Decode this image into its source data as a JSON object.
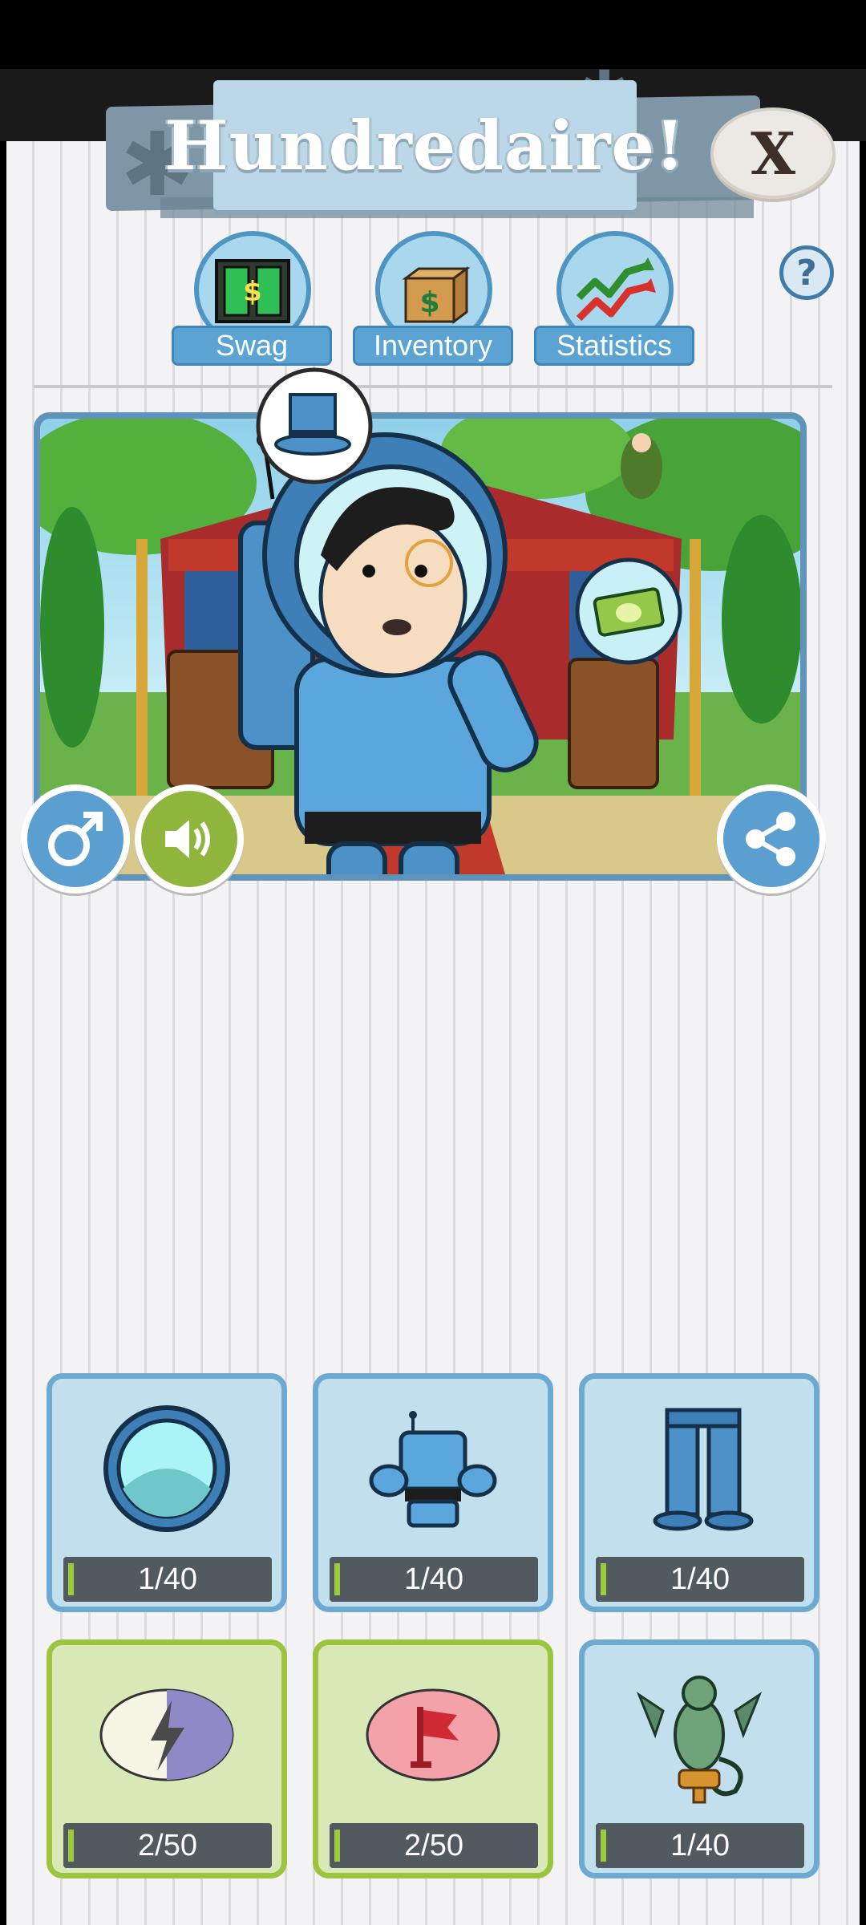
{
  "header": {
    "title": "Hundredaire!",
    "close_label": "X",
    "help_label": "?"
  },
  "tabs": [
    {
      "label": "Swag",
      "icon": "swag-cabinet-icon"
    },
    {
      "label": "Inventory",
      "icon": "inventory-box-icon"
    },
    {
      "label": "Statistics",
      "icon": "statistics-arrows-icon"
    }
  ],
  "controls": {
    "gender_icon": "male-symbol-icon",
    "sound_icon": "speaker-icon",
    "share_icon": "share-icon"
  },
  "slots": [
    {
      "count": "1/40",
      "progress": 0.025,
      "item": "helmet",
      "style": "blue"
    },
    {
      "count": "1/40",
      "progress": 0.025,
      "item": "robot-armor",
      "style": "blue"
    },
    {
      "count": "1/40",
      "progress": 0.025,
      "item": "pants",
      "style": "blue"
    },
    {
      "count": "2/50",
      "progress": 0.04,
      "item": "energy-lightning",
      "style": "green"
    },
    {
      "count": "2/50",
      "progress": 0.04,
      "item": "flag",
      "style": "green"
    },
    {
      "count": "1/40",
      "progress": 0.025,
      "item": "dragon",
      "style": "blue"
    }
  ],
  "colors": {
    "accent_blue": "#5aa3d3",
    "slot_green": "#9cc43e",
    "progress_green": "#9ccc3c"
  }
}
